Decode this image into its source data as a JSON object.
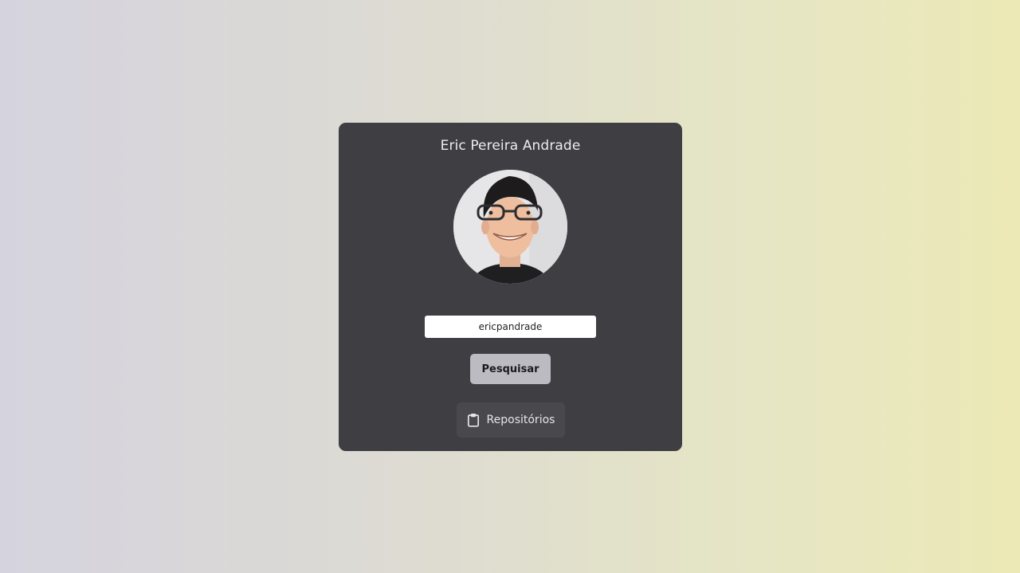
{
  "profile": {
    "name": "Eric Pereira Andrade",
    "avatar_icon": "user-avatar-photo"
  },
  "search": {
    "value": "ericpandrade",
    "button_label": "Pesquisar"
  },
  "repos": {
    "button_label": "Repositórios",
    "icon": "clipboard-icon"
  },
  "colors": {
    "card": "#3f3e43",
    "search_button": "#bdbbc2",
    "repos_button": "#49484d"
  }
}
